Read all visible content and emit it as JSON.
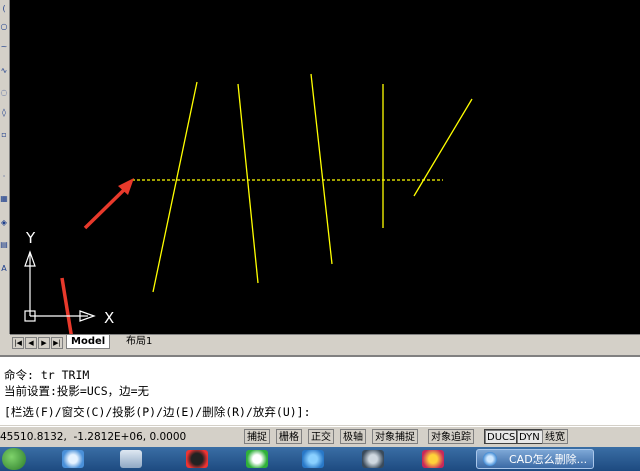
{
  "layout_tabs": {
    "model": "Model",
    "layout1": "布局1"
  },
  "nav_buttons": [
    "|◀",
    "◀",
    "▶",
    "▶|"
  ],
  "ucs": {
    "x_label": "X",
    "y_label": "Y"
  },
  "command_window": {
    "line1": "命令: tr TRIM",
    "line2": "当前设置:投影=UCS，边=无",
    "line3": "[栏选(F)/窗交(C)/投影(P)/边(E)/删除(R)/放弃(U)]:"
  },
  "status": {
    "coordinates": "45510.8132,  -1.2812E+06, 0.0000",
    "buttons": [
      {
        "label": "捕捉",
        "on": false
      },
      {
        "label": "栅格",
        "on": false
      },
      {
        "label": "正交",
        "on": false
      },
      {
        "label": "极轴",
        "on": false
      },
      {
        "label": "对象捕捉",
        "on": false
      },
      {
        "label": "对象追踪",
        "on": false
      },
      {
        "label": "DUCS",
        "on": true
      },
      {
        "label": "DYN",
        "on": true
      },
      {
        "label": "线宽",
        "on": false
      }
    ]
  },
  "taskbar": {
    "active_window_label": "CAD怎么删除..."
  },
  "colors": {
    "drawing_bg": "#000000",
    "lines": "#ffff00",
    "annotation_arrows": "#e8392b",
    "ucs_icon": "#ffffff"
  }
}
